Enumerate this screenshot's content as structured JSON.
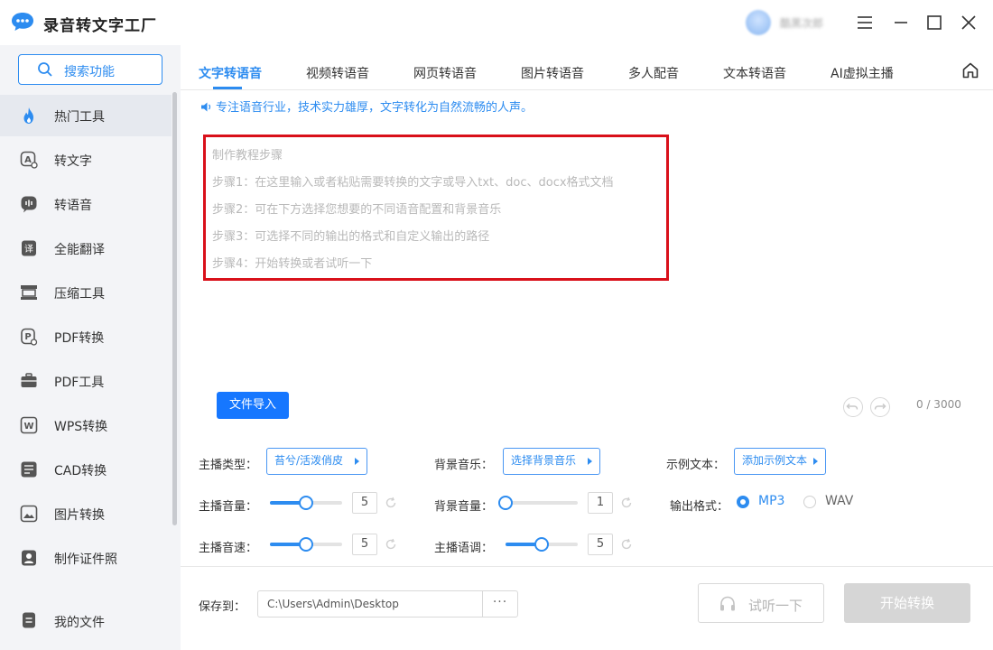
{
  "app": {
    "title": "录音转文字工厂",
    "user_name": "酷黑次郎"
  },
  "colors": {
    "accent": "#2d8cf0",
    "highlight_box": "#d9101a",
    "sidebar_bg": "#f3f4f7"
  },
  "sidebar": {
    "search_label": "搜索功能",
    "items": [
      {
        "label": "热门工具",
        "icon": "flame-icon",
        "active": true
      },
      {
        "label": "转文字",
        "icon": "a-text-icon"
      },
      {
        "label": "转语音",
        "icon": "voice-icon"
      },
      {
        "label": "全能翻译",
        "icon": "translate-icon"
      },
      {
        "label": "压缩工具",
        "icon": "compress-icon"
      },
      {
        "label": "PDF转换",
        "icon": "pdf-convert-icon"
      },
      {
        "label": "PDF工具",
        "icon": "briefcase-icon"
      },
      {
        "label": "WPS转换",
        "icon": "wps-icon"
      },
      {
        "label": "CAD转换",
        "icon": "cad-icon"
      },
      {
        "label": "图片转换",
        "icon": "image-icon"
      },
      {
        "label": "制作证件照",
        "icon": "id-photo-icon"
      }
    ],
    "bottom_label": "我的文件"
  },
  "tabs": [
    {
      "label": "文字转语音",
      "active": true
    },
    {
      "label": "视频转语音"
    },
    {
      "label": "网页转语音"
    },
    {
      "label": "图片转语音"
    },
    {
      "label": "多人配音"
    },
    {
      "label": "文本转语音"
    },
    {
      "label": "AI虚拟主播"
    }
  ],
  "slogan": "专注语音行业，技术实力雄厚，文字转化为自然流畅的人声。",
  "tutorial": {
    "title": "制作教程步骤",
    "steps": [
      "步骤1：在这里输入或者粘贴需要转换的文字或导入txt、doc、docx格式文档",
      "步骤2：可在下方选择您想要的不同语音配置和背景音乐",
      "步骤3：可选择不同的输出的格式和自定义输出的路径",
      "步骤4：开始转换或者试听一下"
    ]
  },
  "editor": {
    "import_label": "文件导入",
    "counter": "0 / 3000"
  },
  "settings": {
    "anchor_type_label": "主播类型：",
    "anchor_type_value": "苔兮/活泼俏皮",
    "bg_music_label": "背景音乐：",
    "bg_music_value": "选择背景音乐",
    "sample_text_label": "示例文本：",
    "sample_text_value": "添加示例文本",
    "anchor_volume_label": "主播音量：",
    "anchor_volume": "5",
    "anchor_volume_fraction": 0.5,
    "bg_volume_label": "背景音量：",
    "bg_volume": "1",
    "bg_volume_fraction": 0.0,
    "output_format_label": "输出格式：",
    "formats": [
      "MP3",
      "WAV"
    ],
    "selected_format": "MP3",
    "anchor_speed_label": "主播音速：",
    "anchor_speed": "5",
    "anchor_speed_fraction": 0.5,
    "anchor_pitch_label": "主播语调：",
    "anchor_pitch": "5",
    "anchor_pitch_fraction": 0.5
  },
  "footer": {
    "save_to_label": "保存到：",
    "save_path": "C:\\Users\\Admin\\Desktop",
    "browse_label": "···",
    "preview_label": "试听一下",
    "start_label": "开始转换"
  }
}
